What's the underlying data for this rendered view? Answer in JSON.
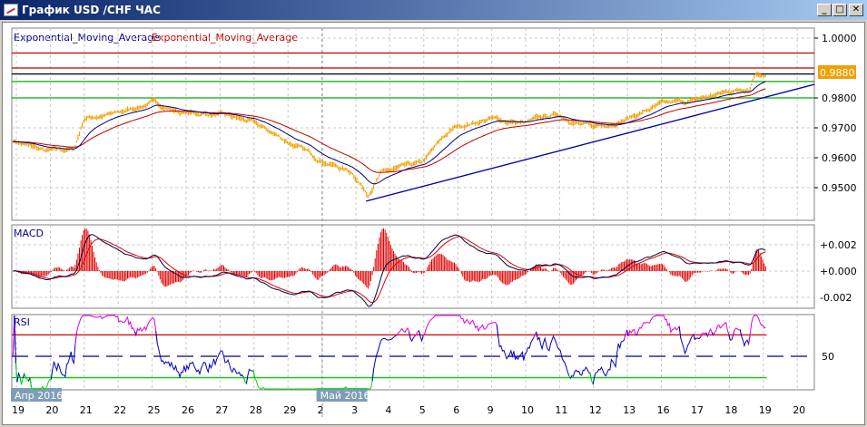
{
  "window": {
    "title": "График USD /CHF  ЧАС",
    "minimize": "_",
    "maximize": "□",
    "close": "✕"
  },
  "legend": {
    "ema1": "Exponential_Moving_Average",
    "ema2": "Exponential_Moving_Average",
    "ema1_color": "#000080",
    "ema2_color": "#c00000"
  },
  "panels": {
    "macd_title": "MACD",
    "rsi_title": "RSI"
  },
  "chart_data": {
    "type": "line",
    "symbol": "USD/CHF",
    "timeframe": "H1",
    "price_axis": {
      "ticks": [
        "1.0000",
        "0.9800",
        "0.9700",
        "0.9600",
        "0.9500"
      ],
      "tick_values": [
        1.0,
        0.98,
        0.97,
        0.96,
        0.95
      ],
      "ylim": [
        0.943,
        1.003
      ]
    },
    "current_price": "0.9880",
    "horizontal_levels": [
      {
        "price": 0.995,
        "color": "#c00000"
      },
      {
        "price": 0.99,
        "color": "#c00000"
      },
      {
        "price": 0.988,
        "color": "#000000"
      },
      {
        "price": 0.9855,
        "color": "#00b000"
      },
      {
        "price": 0.98,
        "color": "#00b000"
      }
    ],
    "trendline": {
      "from": [
        10.3,
        0.9455
      ],
      "to": [
        23.5,
        0.9845
      ]
    },
    "price_keypoints": [
      [
        -0.1,
        0.9658
      ],
      [
        0.9,
        0.962
      ],
      [
        1.7,
        0.9628
      ],
      [
        2.0,
        0.9733
      ],
      [
        3.0,
        0.9748
      ],
      [
        4.0,
        0.9785
      ],
      [
        4.9,
        0.975
      ],
      [
        5.9,
        0.9745
      ],
      [
        6.9,
        0.972
      ],
      [
        7.9,
        0.966
      ],
      [
        8.9,
        0.9597
      ],
      [
        9.9,
        0.955
      ],
      [
        10.35,
        0.948
      ],
      [
        10.75,
        0.955
      ],
      [
        11.95,
        0.958
      ],
      [
        12.6,
        0.967
      ],
      [
        12.95,
        0.9703
      ],
      [
        13.95,
        0.973
      ],
      [
        14.95,
        0.9715
      ],
      [
        15.95,
        0.9745
      ],
      [
        16.95,
        0.97
      ],
      [
        17.95,
        0.973
      ],
      [
        18.95,
        0.9775
      ],
      [
        19.95,
        0.979
      ],
      [
        20.95,
        0.982
      ],
      [
        21.6,
        0.9835
      ],
      [
        21.75,
        0.9887
      ],
      [
        22.1,
        0.9882
      ]
    ],
    "x_ticks": [
      "19",
      "20",
      "21",
      "22",
      "25",
      "26",
      "27",
      "28",
      "29",
      "2",
      "3",
      "4",
      "5",
      "6",
      "9",
      "10",
      "11",
      "12",
      "13",
      "16",
      "17",
      "18",
      "19",
      "20"
    ],
    "month_labels": [
      {
        "text": "Апр 2016",
        "at_tick": 0
      },
      {
        "text": "Май 2016",
        "at_tick": 9
      }
    ],
    "macd": {
      "ticks": [
        "+0.002",
        "+0.000",
        "-0.002"
      ],
      "tick_values": [
        0.002,
        0,
        -0.002
      ]
    },
    "rsi": {
      "ticks": [
        "50"
      ],
      "levels": [
        70,
        50,
        30
      ]
    }
  }
}
